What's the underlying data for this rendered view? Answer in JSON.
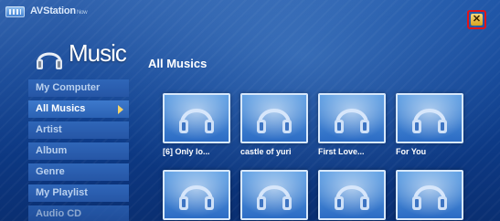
{
  "app": {
    "title": "AVStation",
    "title_suffix": "Now",
    "close_glyph": "✕"
  },
  "header": {
    "section_name": "Music",
    "content_title": "All Musics"
  },
  "sidebar": {
    "items": [
      {
        "label": "My Computer"
      },
      {
        "label": "All Musics"
      },
      {
        "label": "Artist"
      },
      {
        "label": "Album"
      },
      {
        "label": "Genre"
      },
      {
        "label": "My Playlist"
      },
      {
        "label": "Audio CD"
      }
    ]
  },
  "tracks": [
    {
      "title": "[6] Only lo..."
    },
    {
      "title": "castle of yuri"
    },
    {
      "title": "First Love..."
    },
    {
      "title": "For You"
    },
    {
      "title": ""
    },
    {
      "title": ""
    },
    {
      "title": ""
    },
    {
      "title": ""
    }
  ],
  "icons": {
    "tile": "headphones-icon",
    "logo": "headphones-icon",
    "close": "close-icon"
  },
  "colors": {
    "background": "#124596",
    "highlight_border": "#e0141a",
    "active_arrow": "#f2d26a"
  }
}
